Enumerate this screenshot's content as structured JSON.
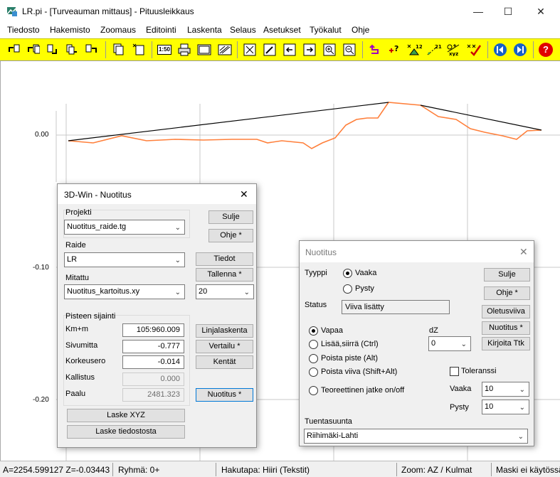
{
  "window": {
    "title": "LR.pi - [Turveauman mittaus] - Pituusleikkaus",
    "minimize": "—",
    "maximize": "☐",
    "close": "✕"
  },
  "menu": [
    "Tiedosto",
    "Hakemisto",
    "Zoomaus",
    "Editointi",
    "Laskenta",
    "Selaus",
    "Asetukset",
    "Työkalut",
    "Ohje"
  ],
  "toolbar": {
    "labels": {
      "scale": "1:50",
      "help": "?"
    }
  },
  "plot": {
    "y_ticks": [
      "0.00",
      "-0.10",
      "-0.20"
    ],
    "colors": {
      "design_line": "#000000",
      "measured_line": "#ff7f3a",
      "grid": "#c8c8c8"
    }
  },
  "statusbar": {
    "coords": "A=2254.599127  Z=-0.03443",
    "group": "Ryhmä: 0+",
    "search_mode": "Hakutapa: Hiiri (Tekstit)",
    "zoom": "Zoom: AZ  /  Kulmat",
    "mask": "Maski ei käytössä"
  },
  "dialog_nuotitus_main": {
    "title": "3D-Win - Nuotitus",
    "close": "✕",
    "project_label": "Projekti",
    "project_value": "Nuotitus_raide.tg",
    "track_label": "Raide",
    "track_value": "LR",
    "measured_label": "Mitattu",
    "measured_value": "Nuotitus_kartoitus.xy",
    "count_value": "20",
    "point_group_label": "Pisteen sijainti",
    "km_label": "Km+m",
    "km_value": "105:960.009",
    "side_label": "Sivumitta",
    "side_value": "-0.777",
    "height_label": "Korkeusero",
    "height_value": "-0.014",
    "cant_label": "Kallistus",
    "cant_value": "0.000",
    "pile_label": "Paalu",
    "pile_value": "2481.323",
    "buttons": {
      "close": "Sulje",
      "help": "Ohje *",
      "info": "Tiedot",
      "save": "Tallenna *",
      "line_calc": "Linjalaskenta",
      "compare": "Vertailu *",
      "fields": "Kentät",
      "nuotitus": "Nuotitus *",
      "calc_xyz": "Laske XYZ",
      "calc_file": "Laske tiedostosta"
    }
  },
  "dialog_nuotitus_tool": {
    "title": "Nuotitus",
    "close": "✕",
    "type_label": "Tyyppi",
    "type_horizontal": "Vaaka",
    "type_vertical": "Pysty",
    "status_label": "Status",
    "status_value": "Viiva lisätty",
    "mode_free": "Vapaa",
    "mode_add": "Lisää,siirrä  (Ctrl)",
    "mode_remove_point": "Poista piste  (Alt)",
    "mode_remove_line": "Poista viiva  (Shift+Alt)",
    "mode_theoretical": "Teoreettinen jatke on/off",
    "dz_label": "dZ",
    "dz_value": "0",
    "tolerance_label": "Toleranssi",
    "horizontal_label": "Vaaka",
    "horizontal_value": "10",
    "vertical_label": "Pysty",
    "vertical_value": "10",
    "support_direction_label": "Tuentasuunta",
    "support_direction_value": "Riihimäki-Lahti",
    "buttons": {
      "close": "Sulje",
      "help": "Ohje *",
      "default_line": "Oletusviiva",
      "nuotitus": "Nuotitus *",
      "write_ttk": "Kirjoita Ttk"
    }
  }
}
